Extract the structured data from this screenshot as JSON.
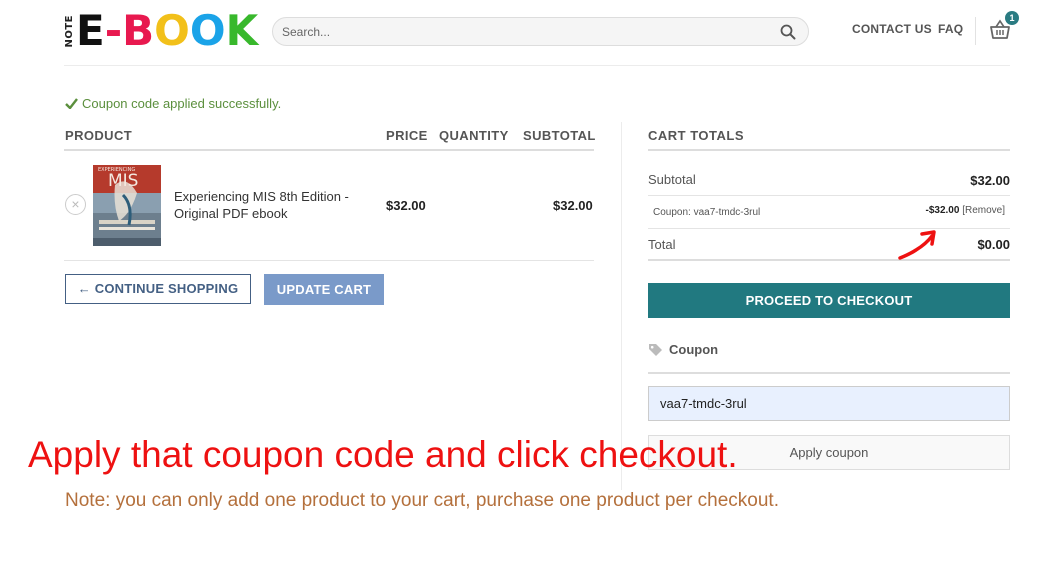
{
  "header": {
    "logo_prefix": "NOTE",
    "logo_letters": [
      {
        "char": "E",
        "color": "#111111"
      },
      {
        "char": "-",
        "color": "#e8194f"
      },
      {
        "char": "B",
        "color": "#e8194f"
      },
      {
        "char": "O",
        "color": "#f2c01a"
      },
      {
        "char": "O",
        "color": "#1aa3e8"
      },
      {
        "char": "K",
        "color": "#38b82c"
      }
    ],
    "search_placeholder": "Search...",
    "nav": {
      "contact": "CONTACT US",
      "faq": "FAQ"
    },
    "cart_count": "1"
  },
  "notice": "Coupon code applied successfully.",
  "cart": {
    "headers": {
      "product": "PRODUCT",
      "price": "PRICE",
      "quantity": "QUANTITY",
      "subtotal": "SUBTOTAL"
    },
    "items": [
      {
        "remove": "×",
        "cover_title": "MIS",
        "cover_top": "EXPERIENCING",
        "name": "Experiencing MIS 8th Edition - Original PDF ebook",
        "price": "$32.00",
        "subtotal": "$32.00"
      }
    ],
    "continue_label": "← CONTINUE SHOPPING",
    "update_label": "UPDATE CART"
  },
  "totals": {
    "title": "CART TOTALS",
    "subtotal_label": "Subtotal",
    "subtotal_value": "$32.00",
    "coupon_label": "Coupon: vaa7-tmdc-3rul",
    "coupon_amount": "-$32.00",
    "coupon_remove": "[Remove]",
    "total_label": "Total",
    "total_value": "$0.00",
    "checkout_label": "PROCEED TO CHECKOUT"
  },
  "coupon": {
    "heading": "Coupon",
    "code_value": "vaa7-tmdc-3rul",
    "apply_label": "Apply coupon"
  },
  "annotations": {
    "instruction": "Apply that coupon code and click checkout.",
    "note": "Note: you can only add one product to your cart, purchase one product per checkout.",
    "arrow_color": "#ee1111"
  }
}
